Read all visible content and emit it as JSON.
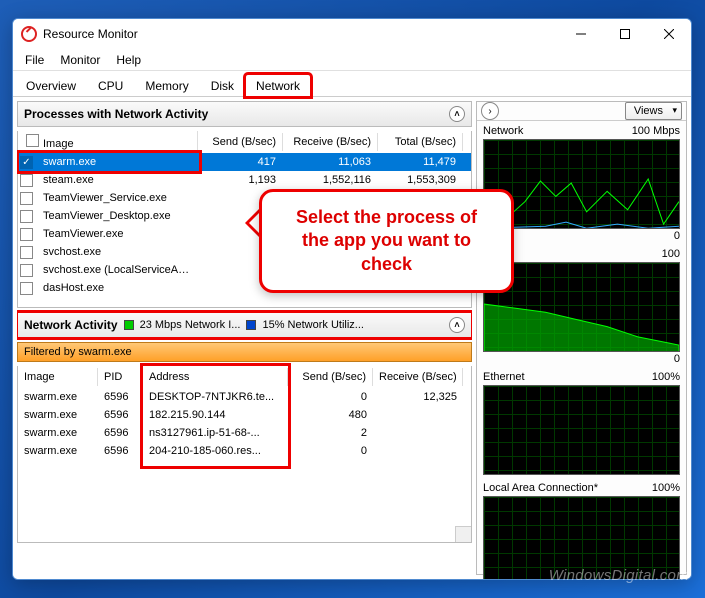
{
  "titlebar": {
    "title": "Resource Monitor"
  },
  "menu": [
    "File",
    "Monitor",
    "Help"
  ],
  "tabs": [
    "Overview",
    "CPU",
    "Memory",
    "Disk",
    "Network"
  ],
  "active_tab": "Network",
  "panel1": {
    "title": "Processes with Network Activity",
    "columns": [
      "Image",
      "Send (B/sec)",
      "Receive (B/sec)",
      "Total (B/sec)"
    ],
    "rows": [
      {
        "checked": true,
        "image": "swarm.exe",
        "send": "417",
        "recv": "11,063",
        "total": "11,479"
      },
      {
        "checked": false,
        "image": "steam.exe",
        "send": "1,193",
        "recv": "1,552,116",
        "total": "1,553,309"
      },
      {
        "checked": false,
        "image": "TeamViewer_Service.exe",
        "send": "",
        "recv": "",
        "total": ""
      },
      {
        "checked": false,
        "image": "TeamViewer_Desktop.exe",
        "send": "",
        "recv": "",
        "total": ""
      },
      {
        "checked": false,
        "image": "TeamViewer.exe",
        "send": "",
        "recv": "",
        "total": ""
      },
      {
        "checked": false,
        "image": "svchost.exe",
        "send": "",
        "recv": "",
        "total": ""
      },
      {
        "checked": false,
        "image": "svchost.exe (LocalServiceAn...",
        "send": "",
        "recv": "",
        "total": ""
      },
      {
        "checked": false,
        "image": "dasHost.exe",
        "send": "",
        "recv": "",
        "total": ""
      }
    ]
  },
  "panel2": {
    "title": "Network Activity",
    "legend_io": "23 Mbps Network I...",
    "legend_util": "15% Network Utiliz...",
    "filter": "Filtered by swarm.exe",
    "columns": [
      "Image",
      "PID",
      "Address",
      "Send (B/sec)",
      "Receive (B/sec)"
    ],
    "rows": [
      {
        "image": "swarm.exe",
        "pid": "6596",
        "addr": "DESKTOP-7NTJKR6.te...",
        "send": "0",
        "recv": "12,325"
      },
      {
        "image": "swarm.exe",
        "pid": "6596",
        "addr": "182.215.90.144",
        "send": "480",
        "recv": ""
      },
      {
        "image": "swarm.exe",
        "pid": "6596",
        "addr": "ns3127961.ip-51-68-...",
        "send": "2",
        "recv": ""
      },
      {
        "image": "swarm.exe",
        "pid": "6596",
        "addr": "204-210-185-060.res...",
        "send": "0",
        "recv": ""
      }
    ]
  },
  "right": {
    "views": "Views",
    "graphs": [
      {
        "label": "Network",
        "max": "100 Mbps",
        "min": "0"
      },
      {
        "label": "",
        "max": "100",
        "min": "0"
      },
      {
        "label": "Ethernet",
        "max": "100%",
        "min": ""
      },
      {
        "label": "Local Area Connection*",
        "max": "100%",
        "min": ""
      }
    ]
  },
  "callout": "Select the process of the app you want to check",
  "watermark": "WindowsDigital.com"
}
